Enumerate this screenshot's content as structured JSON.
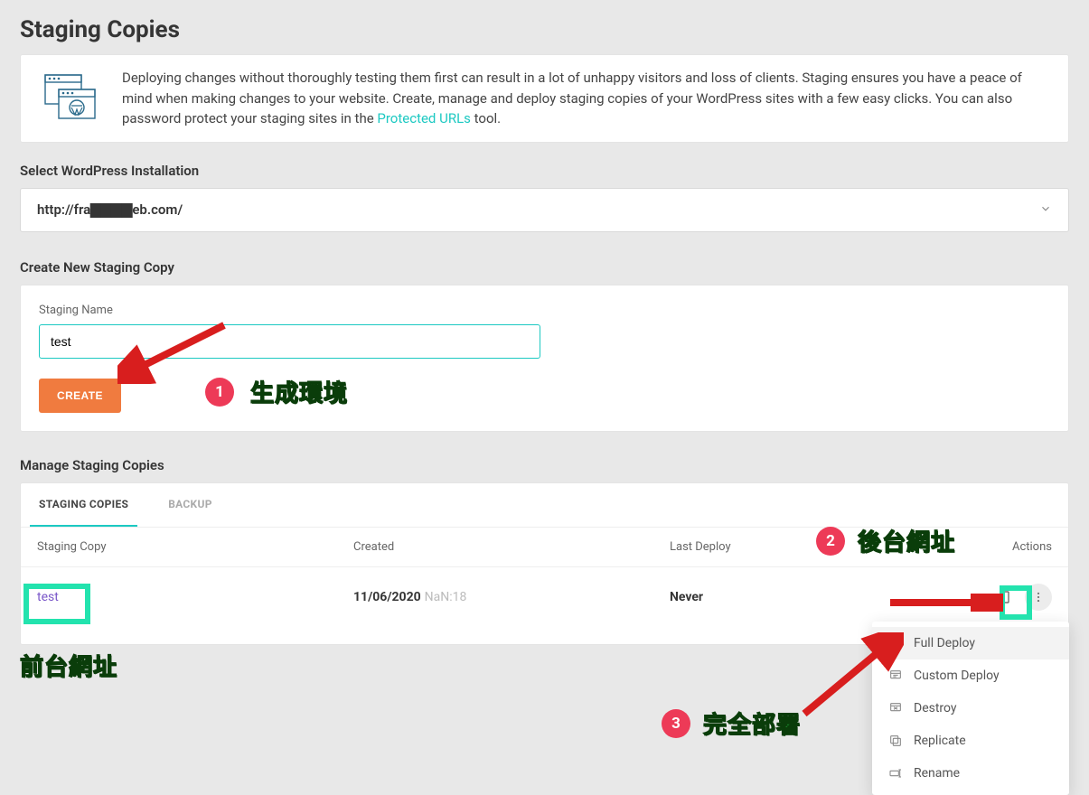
{
  "page": {
    "title": "Staging Copies"
  },
  "intro": {
    "text_before_link": "Deploying changes without thoroughly testing them first can result in a lot of unhappy visitors and loss of clients. Staging ensures you have a peace of mind when making changes to your website. Create, manage and deploy staging copies of your WordPress sites with a few easy clicks. You can also password protect your staging sites in the ",
    "link_text": "Protected URLs",
    "text_after_link": " tool."
  },
  "select": {
    "label": "Select WordPress Installation",
    "value": "http://fra▇▇▇▇eb.com/"
  },
  "create": {
    "heading": "Create New Staging Copy",
    "field_label": "Staging Name",
    "input_value": "test",
    "button": "CREATE"
  },
  "manage": {
    "heading": "Manage Staging Copies",
    "tabs": {
      "staging": "STAGING COPIES",
      "backup": "BACKUP"
    },
    "columns": {
      "name": "Staging Copy",
      "created": "Created",
      "deploy": "Last Deploy",
      "actions": "Actions"
    },
    "row": {
      "name": "test",
      "created_date": "11/06/2020",
      "created_time": "NaN:18",
      "last_deploy": "Never"
    }
  },
  "dropdown": {
    "full_deploy": "Full Deploy",
    "custom_deploy": "Custom Deploy",
    "destroy": "Destroy",
    "replicate": "Replicate",
    "rename": "Rename"
  },
  "annotations": {
    "n1": "1",
    "t1": "生成環境",
    "n2": "2",
    "t2": "後台網址",
    "n3": "3",
    "t3": "完全部署",
    "front": "前台網址"
  }
}
